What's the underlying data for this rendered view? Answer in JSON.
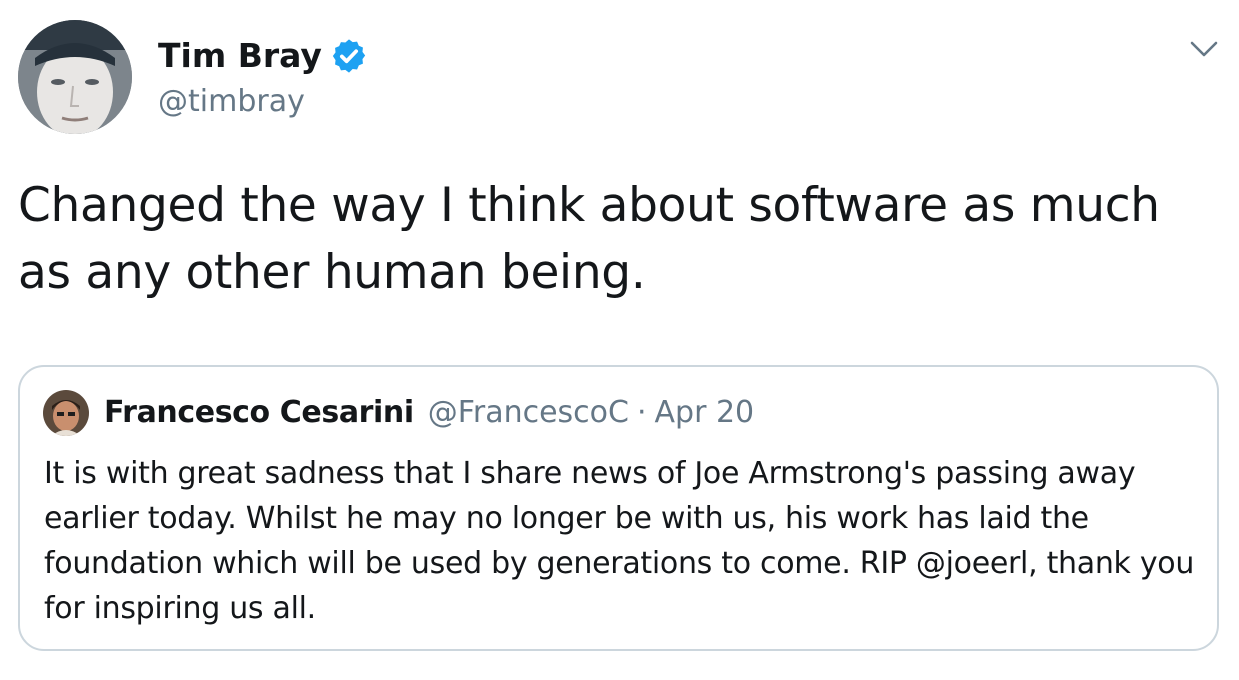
{
  "author": {
    "name": "Tim Bray",
    "handle": "@timbray",
    "avatar_icon": "profile-photo",
    "verified_icon": "verified-badge-icon",
    "verified_color": "#1da1f2"
  },
  "menu": {
    "icon": "chevron-down-icon"
  },
  "tweet": {
    "text": "Changed the way I think about software as much as any other human being."
  },
  "quote": {
    "name": "Francesco Cesarini",
    "handle": "@FrancescoC",
    "separator": "·",
    "date": "Apr 20",
    "text": "It is with great sadness that I share news of Joe Armstrong's passing away earlier today. Whilst he may no longer be with us, his work has laid the foundation which will be used by generations to come. RIP @joeerl, thank you for inspiring us all."
  },
  "colors": {
    "text_primary": "#14171a",
    "text_secondary": "#657786",
    "border": "#ccd6dd"
  }
}
